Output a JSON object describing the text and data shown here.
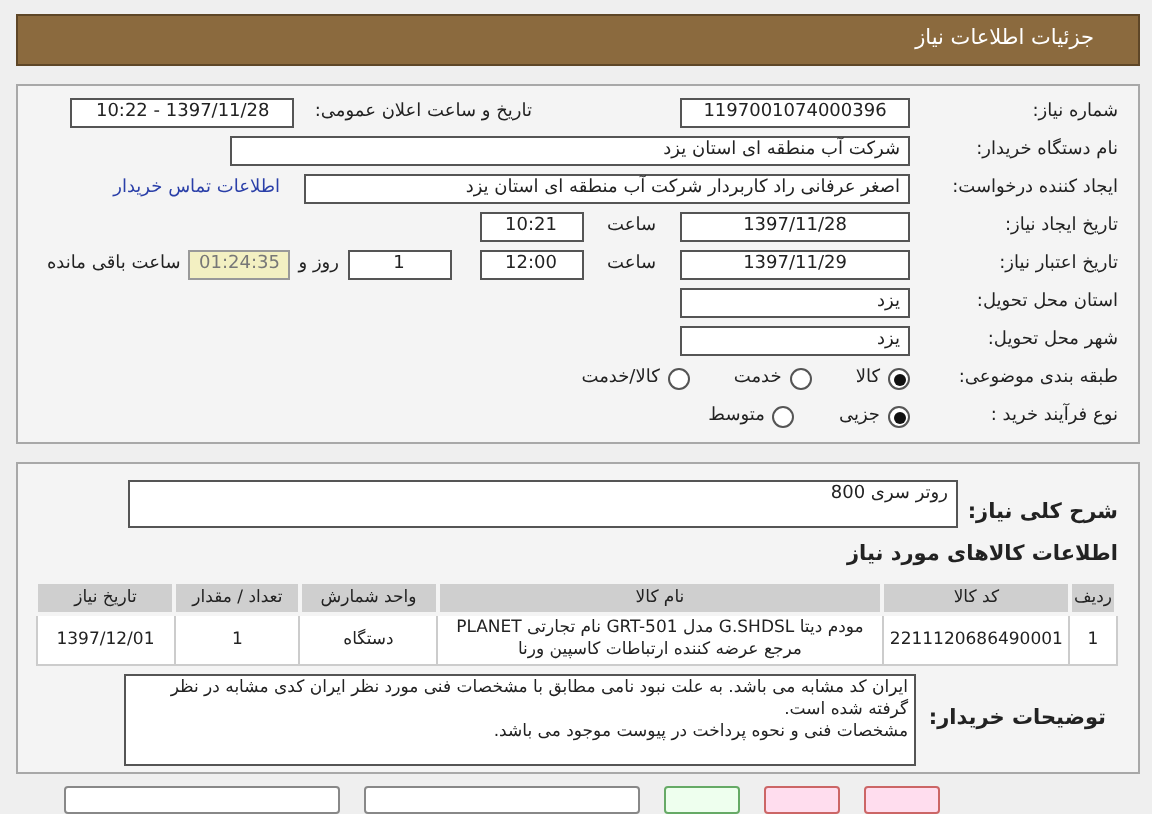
{
  "header": {
    "title": "جزئیات اطلاعات نیاز"
  },
  "details": {
    "need_number": {
      "label": "شماره نیاز:",
      "value": "1197001074000396"
    },
    "announce": {
      "label": "تاریخ و ساعت اعلان عمومی:",
      "value": "1397/11/28 - 10:22"
    },
    "buyer_org": {
      "label": "نام دستگاه خریدار:",
      "value": "شرکت آب منطقه ای استان یزد"
    },
    "creator": {
      "label": "ایجاد کننده درخواست:",
      "value": "اصغر عرفانی راد کاربردار شرکت آب منطقه ای استان یزد",
      "link": "اطلاعات تماس خریدار"
    },
    "created": {
      "label": "تاریخ ایجاد نیاز:",
      "date": "1397/11/28",
      "time_label": "ساعت",
      "time": "10:21"
    },
    "validity": {
      "label": "تاریخ اعتبار نیاز:",
      "date": "1397/11/29",
      "time_label": "ساعت",
      "time": "12:00",
      "days": "1",
      "days_label": "روز و",
      "remaining": "01:24:35",
      "remaining_label": "ساعت باقی مانده"
    },
    "province": {
      "label": "استان محل تحویل:",
      "value": "یزد"
    },
    "city": {
      "label": "شهر محل تحویل:",
      "value": "یزد"
    },
    "category": {
      "label": "طبقه بندی موضوعی:",
      "options": [
        {
          "label": "کالا",
          "selected": true
        },
        {
          "label": "خدمت",
          "selected": false
        },
        {
          "label": "کالا/خدمت",
          "selected": false
        }
      ]
    },
    "process": {
      "label": "نوع فرآیند خرید :",
      "options": [
        {
          "label": "جزیی",
          "selected": true
        },
        {
          "label": "متوسط",
          "selected": false
        }
      ]
    }
  },
  "summary": {
    "label": "شرح کلی نیاز:",
    "value": "روتر سری 800"
  },
  "goods": {
    "title": "اطلاعات کالاهای مورد نیاز",
    "columns": [
      "ردیف",
      "کد کالا",
      "نام کالا",
      "واحد شمارش",
      "تعداد / مقدار",
      "تاریخ نیاز"
    ],
    "rows": [
      [
        "1",
        "2211120686490001",
        "مودم دیتا G.SHDSL مدل GRT-501 نام تجارتی PLANET مرجع عرضه کننده ارتباطات کاسپین ورنا",
        "دستگاه",
        "1",
        "1397/12/01"
      ]
    ]
  },
  "notes": {
    "label": "توضیحات خریدار:",
    "lines": [
      "ایران کد مشابه می باشد. به علت نبود نامی مطابق با مشخصات فنی مورد نظر ایران کدی مشابه در نظر گرفته شده است.",
      "مشخصات فنی و نحوه پرداخت در پیوست موجود می باشد."
    ]
  }
}
